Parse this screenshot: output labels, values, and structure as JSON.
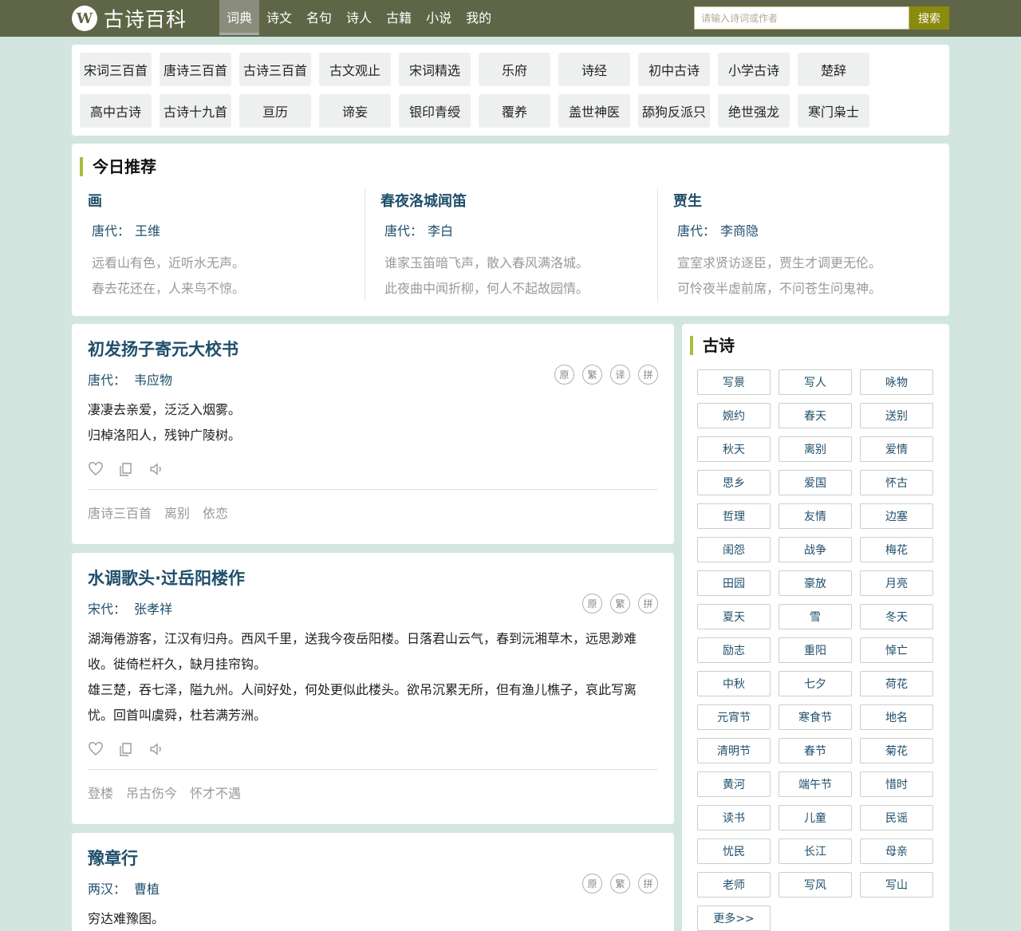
{
  "header": {
    "logo_glyph": "W",
    "site_title": "古诗百科",
    "nav": [
      "词典",
      "诗文",
      "名句",
      "诗人",
      "古籍",
      "小说",
      "我的"
    ],
    "active_nav": "词典",
    "search_placeholder": "请输入诗词或作者",
    "search_label": "搜索"
  },
  "categories": [
    "宋词三百首",
    "唐诗三百首",
    "古诗三百首",
    "古文观止",
    "宋词精选",
    "乐府",
    "诗经",
    "初中古诗",
    "小学古诗",
    "楚辞",
    "高中古诗",
    "古诗十九首",
    "亘历",
    "谛妄",
    "银印青绶",
    "覆养",
    "盖世神医",
    "舔狗反派只",
    "绝世强龙",
    "寒门枭士"
  ],
  "recommend": {
    "title": "今日推荐",
    "items": [
      {
        "title": "画",
        "dynasty": "唐代：",
        "author": "王维",
        "lines": [
          "远看山有色，近听水无声。",
          "春去花还在，人来鸟不惊。"
        ]
      },
      {
        "title": "春夜洛城闻笛",
        "dynasty": "唐代：",
        "author": "李白",
        "lines": [
          "谁家玉笛暗飞声，散入春风满洛城。",
          "此夜曲中闻折柳，何人不起故园情。"
        ]
      },
      {
        "title": "贾生",
        "dynasty": "唐代：",
        "author": "李商隐",
        "lines": [
          "宣室求贤访逐臣，贾生才调更无伦。",
          "可怜夜半虚前席，不问苍生问鬼神。"
        ]
      }
    ]
  },
  "poems": [
    {
      "title": "初发扬子寄元大校书",
      "dynasty": "唐代：",
      "author": "韦应物",
      "badges": [
        "原",
        "繁",
        "译",
        "拼"
      ],
      "lines": [
        "凄凄去亲爱，泛泛入烟雾。",
        "归棹洛阳人，残钟广陵树。"
      ],
      "tags": [
        "唐诗三百首",
        "离别",
        "依恋"
      ]
    },
    {
      "title": "水调歌头·过岳阳楼作",
      "dynasty": "宋代：",
      "author": "张孝祥",
      "badges": [
        "原",
        "繁",
        "拼"
      ],
      "lines": [
        "湖海倦游客，江汉有归舟。西风千里，送我今夜岳阳楼。日落君山云气，春到沅湘草木，远思渺难收。徙倚栏杆久，缺月挂帘钩。",
        "雄三楚，吞七泽，隘九州。人间好处，何处更似此楼头。欲吊沉累无所，但有渔儿樵子，哀此写离忧。回首叫虞舜，杜若满芳洲。"
      ],
      "tags": [
        "登楼",
        "吊古伤今",
        "怀才不遇"
      ]
    },
    {
      "title": "豫章行",
      "dynasty": "两汉：",
      "author": "曹植",
      "badges": [
        "原",
        "繁",
        "拼"
      ],
      "lines": [
        "穷达难豫图。"
      ],
      "tags": []
    }
  ],
  "sidebar": {
    "title": "古诗",
    "tags": [
      "写景",
      "写人",
      "咏物",
      "婉约",
      "春天",
      "送别",
      "秋天",
      "离别",
      "爱情",
      "思乡",
      "爱国",
      "怀古",
      "哲理",
      "友情",
      "边塞",
      "闺怨",
      "战争",
      "梅花",
      "田园",
      "豪放",
      "月亮",
      "夏天",
      "雪",
      "冬天",
      "励志",
      "重阳",
      "悼亡",
      "中秋",
      "七夕",
      "荷花",
      "元宵节",
      "寒食节",
      "地名",
      "清明节",
      "春节",
      "菊花",
      "黄河",
      "端午节",
      "惜时",
      "读书",
      "儿童",
      "民谣",
      "忧民",
      "长江",
      "母亲",
      "老师",
      "写风",
      "写山"
    ],
    "more": "更多>>"
  },
  "icons": [
    "heart-icon",
    "copy-icon",
    "speaker-icon"
  ],
  "colors": {
    "topbar": "#5e6647",
    "accent": "#a6bf3a",
    "title_blue": "#1f4e6b",
    "background": "#d2e6df",
    "search_button": "#8a8a0e"
  }
}
